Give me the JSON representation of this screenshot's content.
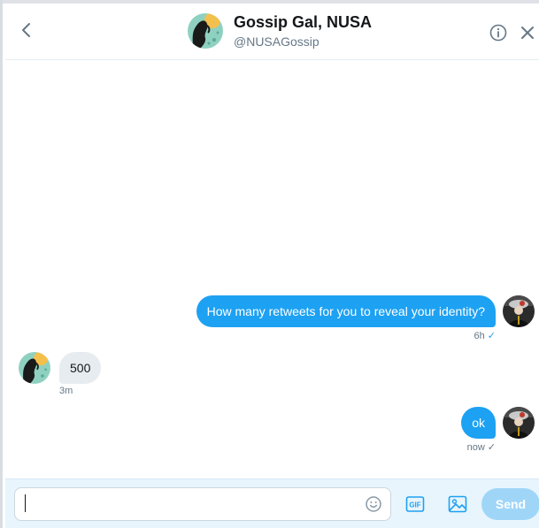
{
  "header": {
    "name": "Gossip Gal, NUSA",
    "handle": "@NUSAGossip"
  },
  "messages": [
    {
      "direction": "sent",
      "text": "How many retweets for you to reveal your identity?",
      "time": "6h",
      "read": true
    },
    {
      "direction": "received",
      "text": "500",
      "time": "3m"
    },
    {
      "direction": "sent",
      "text": "ok",
      "time": "now",
      "read": false
    }
  ],
  "composer": {
    "placeholder": "",
    "value": "",
    "gif_label": "GIF",
    "send_label": "Send"
  },
  "icons": {
    "back": "chevron-left-icon",
    "info": "info-icon",
    "close": "close-icon",
    "emoji": "emoji-icon",
    "gif": "gif-icon",
    "media": "image-icon",
    "read_check": "checkmark-icon"
  },
  "colors": {
    "accent": "#1da1f2",
    "send_disabled": "#9fd6f8",
    "received_bubble": "#e6ecf0",
    "composer_bg": "#e8f5fd"
  }
}
